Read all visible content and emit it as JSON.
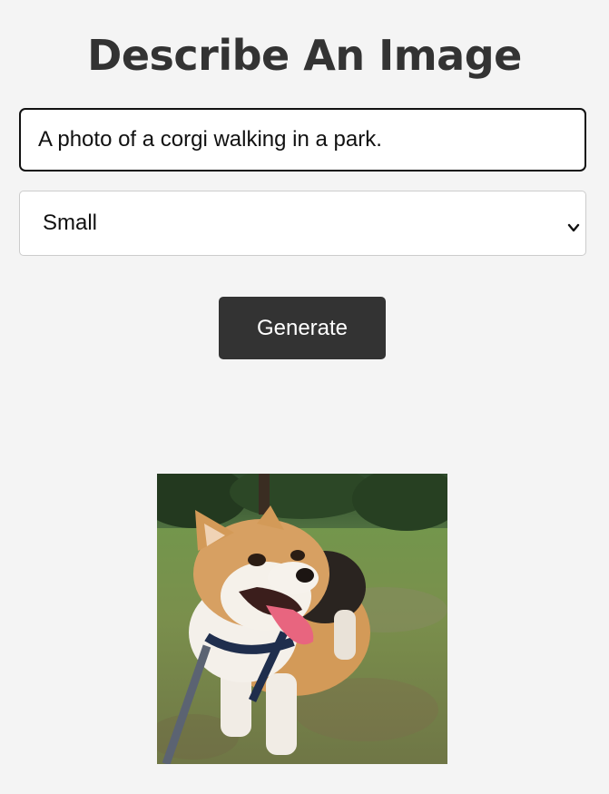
{
  "page": {
    "title": "Describe An Image"
  },
  "form": {
    "prompt_value": "A photo of a corgi walking in a park.",
    "size_selected": "Small",
    "generate_label": "Generate"
  },
  "result": {
    "image_alt": "A photo of a corgi walking in a park."
  },
  "colors": {
    "background": "#f4f4f4",
    "button": "#333333",
    "title": "#333333"
  },
  "icons": {
    "select_arrow": "chevron-down-icon"
  }
}
